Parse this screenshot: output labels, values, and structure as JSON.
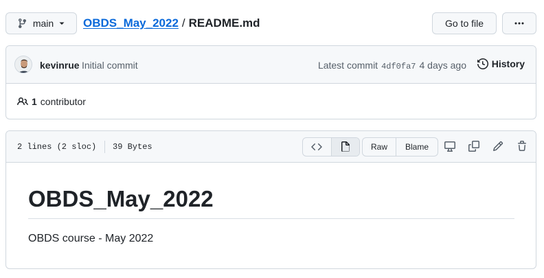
{
  "branch": {
    "name": "main"
  },
  "breadcrumb": {
    "repo": "OBDS_May_2022",
    "separator": "/",
    "file": "README.md"
  },
  "actions": {
    "goto_file": "Go to file",
    "more": "···"
  },
  "commit": {
    "author": "kevinrue",
    "message": "Initial commit",
    "latest_label": "Latest commit",
    "sha": "4df0fa7",
    "age": "4 days ago",
    "history_label": "History"
  },
  "contributors": {
    "count": "1",
    "label": "contributor"
  },
  "file": {
    "lines": "2 lines (2 sloc)",
    "size": "39 Bytes",
    "raw_label": "Raw",
    "blame_label": "Blame"
  },
  "readme": {
    "title": "OBDS_May_2022",
    "body": "OBDS course - May 2022"
  },
  "icons": {
    "branch": "git-branch-icon",
    "dropdown": "triangle-down-icon",
    "history": "history-icon",
    "people": "people-icon",
    "code": "code-icon",
    "file": "file-icon",
    "desktop": "desktop-icon",
    "copy": "copy-icon",
    "pencil": "pencil-icon",
    "trash": "trash-icon"
  },
  "colors": {
    "link": "#0969da",
    "border": "#d0d7de",
    "header_bg": "#f6f8fa",
    "muted": "#57606a"
  }
}
